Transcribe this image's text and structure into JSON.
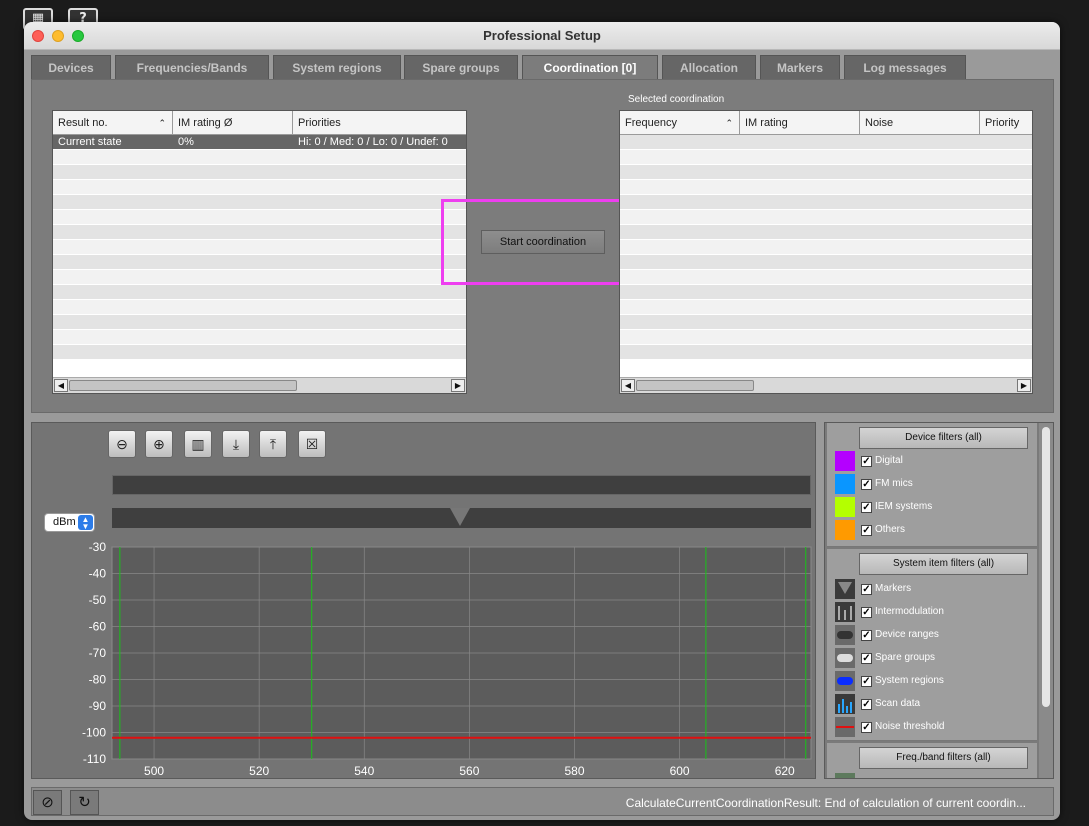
{
  "window": {
    "title": "Professional Setup"
  },
  "desktop": {
    "icon_a": "▦",
    "icon_b": "?"
  },
  "tabs": [
    {
      "label": "Devices",
      "active": false
    },
    {
      "label": "Frequencies/Bands",
      "active": false
    },
    {
      "label": "System regions",
      "active": false
    },
    {
      "label": "Spare groups",
      "active": false
    },
    {
      "label": "Coordination [0]",
      "active": true
    },
    {
      "label": "Allocation",
      "active": false
    },
    {
      "label": "Markers",
      "active": false
    },
    {
      "label": "Log messages",
      "active": false
    }
  ],
  "results_table": {
    "columns": [
      "Result no.",
      "IM rating Ø",
      "Priorities"
    ],
    "rows": [
      {
        "result_no": "Current state",
        "im_rating": "0%",
        "priorities": "Hi: 0 / Med: 0 / Lo: 0 / Undef: 0"
      }
    ]
  },
  "start_button": {
    "label": "Start coordination"
  },
  "selected_coordination": {
    "label": "Selected coordination",
    "columns": [
      "Frequency",
      "IM rating",
      "Noise",
      "Priority"
    ]
  },
  "unit_select": {
    "value": "dBm"
  },
  "toolbar_icons": [
    "zoom-out-icon",
    "zoom-in-icon",
    "fit-icon",
    "import-scan-icon",
    "export-scan-icon",
    "clear-icon"
  ],
  "chart_data": {
    "type": "line",
    "x_ticks": [
      500,
      520,
      540,
      560,
      580,
      600,
      620
    ],
    "y_ticks": [
      -30,
      -40,
      -50,
      -60,
      -70,
      -80,
      -90,
      -100,
      -110
    ],
    "xlim": [
      492,
      625
    ],
    "ylim": [
      -110,
      -30
    ],
    "grid": true,
    "band_edges": [
      493.5,
      530,
      605,
      624
    ],
    "marker_x": 558,
    "series": [
      {
        "name": "Noise threshold",
        "values": [
          {
            "x": 492,
            "y": -102
          },
          {
            "x": 625,
            "y": -102
          }
        ],
        "color": "#e01010"
      }
    ]
  },
  "device_filters": {
    "header": "Device filters (all)",
    "items": [
      {
        "label": "Digital",
        "color": "#b400ff",
        "checked": true
      },
      {
        "label": "FM mics",
        "color": "#0a96ff",
        "checked": true
      },
      {
        "label": "IEM systems",
        "color": "#b4ff00",
        "checked": true
      },
      {
        "label": "Others",
        "color": "#ff9a00",
        "checked": true
      }
    ]
  },
  "system_filters": {
    "header": "System item filters (all)",
    "items": [
      {
        "label": "Markers",
        "icon": "marker-icon",
        "checked": true
      },
      {
        "label": "Intermodulation",
        "icon": "intermodulation-icon",
        "checked": true
      },
      {
        "label": "Device ranges",
        "icon": "device-range-icon",
        "checked": true
      },
      {
        "label": "Spare groups",
        "icon": "spare-group-icon",
        "checked": true
      },
      {
        "label": "System regions",
        "icon": "system-region-icon",
        "checked": true
      },
      {
        "label": "Scan data",
        "icon": "scan-data-icon",
        "checked": true
      },
      {
        "label": "Noise threshold",
        "icon": "noise-threshold-icon",
        "checked": true
      }
    ]
  },
  "freq_filters": {
    "header": "Freq./band filters (all)"
  },
  "status": {
    "text": "CalculateCurrentCoordinationResult: End of calculation of current coordin..."
  },
  "colors": {
    "highlight": "#ee3ef0",
    "noise_threshold": "#e01010",
    "band_edge": "#19c219"
  }
}
